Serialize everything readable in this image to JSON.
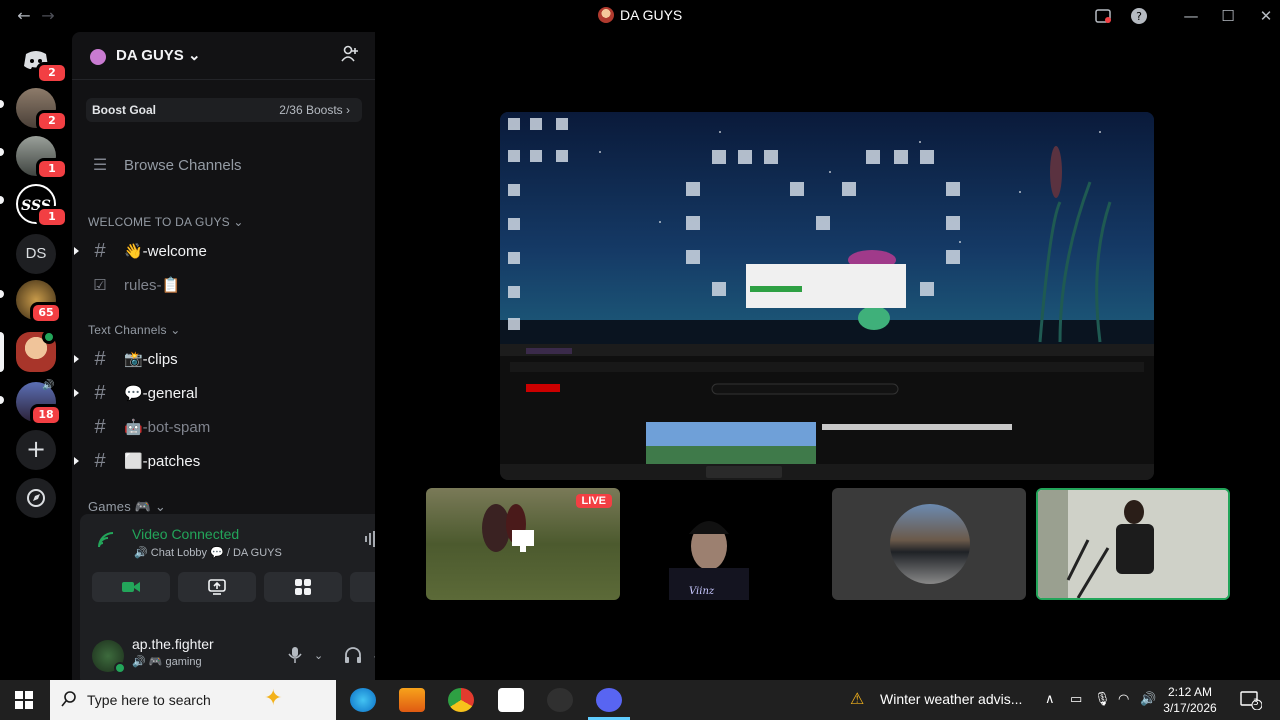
{
  "window": {
    "title": "DA GUYS"
  },
  "servers": [
    {
      "name": "Discord home",
      "badge": "2"
    },
    {
      "name": "DM user 1",
      "badge": "2"
    },
    {
      "name": "DM user 2",
      "badge": "1"
    },
    {
      "name": "SSS server",
      "badge": "1"
    },
    {
      "name": "DS",
      "label": "DS"
    },
    {
      "name": "Ghosts server",
      "badge": "65"
    },
    {
      "name": "DA GUYS"
    },
    {
      "name": "Voice server",
      "badge": "18"
    }
  ],
  "sidebar": {
    "server_name": "DA GUYS",
    "boost": {
      "label": "Boost Goal",
      "count": "2/36 Boosts"
    },
    "browse": "Browse Channels",
    "categories": {
      "welcome": "WELCOME TO DA GUYS",
      "text": "Text Channels",
      "games": "Games 🎮"
    },
    "channels": {
      "welcome": "👋-welcome",
      "rules": "rules-📋",
      "clips": "📸-clips",
      "general": "💬-general",
      "bot_spam": "🤖-bot-spam",
      "patches": "⬜-patches"
    }
  },
  "voice": {
    "status": "Video Connected",
    "location": "Chat Lobby 💬 / DA GUYS"
  },
  "user": {
    "name": "ap.the.fighter",
    "status": "🎮 gaming"
  },
  "stage": {
    "live_label": "LIVE",
    "watermark": "Viinz"
  },
  "taskbar": {
    "search_placeholder": "Type here to search",
    "weather": "Winter weather advis...",
    "time": "2:12 AM",
    "date": "3/17/2026",
    "notifications": "3"
  },
  "colors": {
    "accent_green": "#23a55a",
    "badge_red": "#f23f43",
    "sidebar_bg": "#121214"
  }
}
